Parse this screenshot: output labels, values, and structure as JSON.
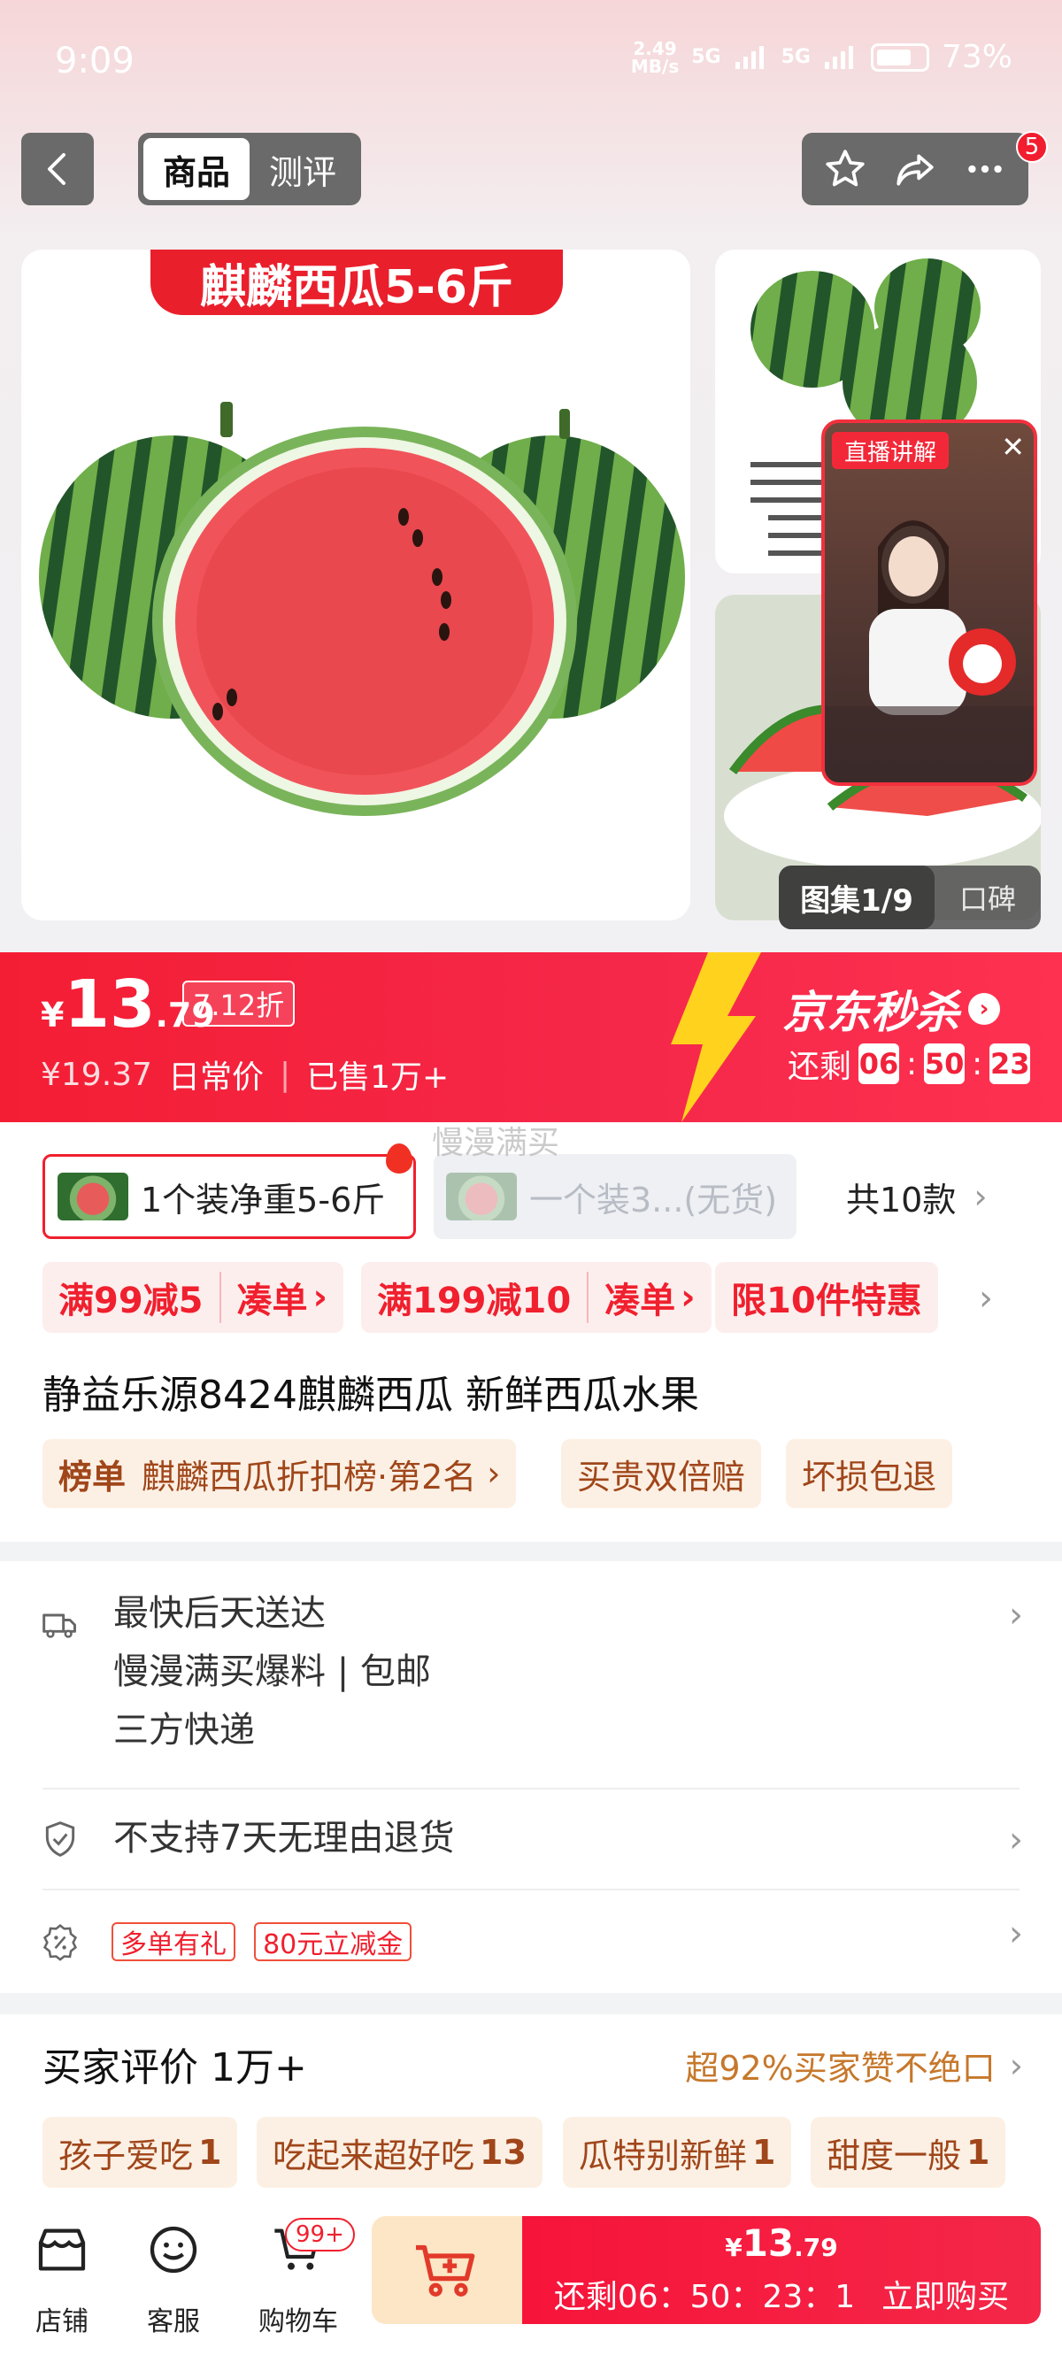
{
  "status_bar": {
    "time": "9:09",
    "net_speed": "2.49\nMB/s",
    "signal1": "5G",
    "signal2": "5G",
    "battery": "73%"
  },
  "header": {
    "tabs": [
      {
        "label": "商品",
        "active": true
      },
      {
        "label": "测评",
        "active": false
      }
    ],
    "badge": "5"
  },
  "gallery": {
    "banner": "麒麟西瓜5-6斤",
    "live_tag": "直播讲解",
    "counter": "图集1/9",
    "reviews_tab": "口碑"
  },
  "price": {
    "currency": "¥",
    "integer": "13",
    "decimal": ".79",
    "discount": "7.12折",
    "old_price": "¥19.37",
    "old_label": "日常价",
    "sold": "已售1万+",
    "seckill": "京东秒杀",
    "countdown_label": "还剩",
    "hh": "06",
    "mm": "50",
    "ss": "23"
  },
  "variants": [
    {
      "label": "1个装净重5-6斤",
      "selected": true
    },
    {
      "label": "一个装3...(无货)",
      "selected": false
    },
    {
      "label": "共10款"
    }
  ],
  "watermark": "慢漫满买",
  "promos": [
    {
      "main": "满99减5",
      "sub": "凑单"
    },
    {
      "main": "满199减10",
      "sub": "凑单"
    },
    {
      "main": "限10件特惠"
    }
  ],
  "product_title": "静益乐源8424麒麟西瓜 新鲜西瓜水果",
  "ranking": {
    "label": "榜单",
    "text": "麒麟西瓜折扣榜·第2名"
  },
  "guarantees": [
    "买贵双倍赔",
    "坏损包退"
  ],
  "delivery": {
    "line1": "最快后天送达",
    "line2": "慢漫满买爆料 | 包邮",
    "line3": "三方快递"
  },
  "returns": "不支持7天无理由退货",
  "coupons": [
    "多单有礼",
    "80元立减金"
  ],
  "reviews": {
    "title": "买家评价 1万+",
    "praise": "超92%买家赞不绝口",
    "tags": [
      {
        "text": "孩子爱吃",
        "count": "1"
      },
      {
        "text": "吃起来超好吃",
        "count": "13"
      },
      {
        "text": "瓜特别新鲜",
        "count": "1"
      },
      {
        "text": "甜度一般",
        "count": "1"
      }
    ]
  },
  "bottom_bar": {
    "shop": "店铺",
    "service": "客服",
    "cart": "购物车",
    "cart_badge": "99+",
    "buy_price_currency": "¥",
    "buy_price": "13",
    "buy_price_dec": ".79",
    "buy_countdown": "还剩06：50：23：1",
    "buy_label": "立即购买"
  },
  "colors": {
    "accent": "#f0202e",
    "gold": "#c6782c",
    "chip_bg": "#fcf0e4"
  }
}
